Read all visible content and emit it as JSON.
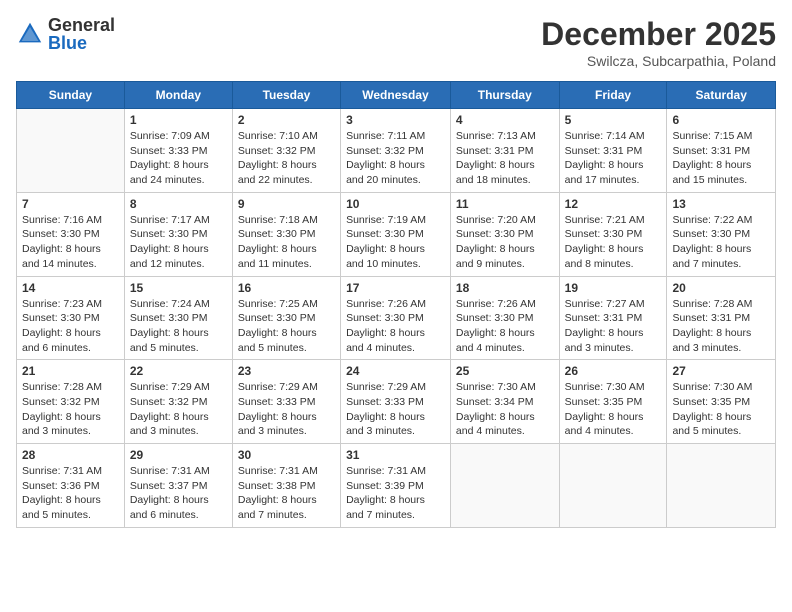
{
  "header": {
    "logo_general": "General",
    "logo_blue": "Blue",
    "month": "December 2025",
    "location": "Swilcza, Subcarpathia, Poland"
  },
  "weekdays": [
    "Sunday",
    "Monday",
    "Tuesday",
    "Wednesday",
    "Thursday",
    "Friday",
    "Saturday"
  ],
  "weeks": [
    [
      {
        "day": "",
        "info": ""
      },
      {
        "day": "1",
        "info": "Sunrise: 7:09 AM\nSunset: 3:33 PM\nDaylight: 8 hours\nand 24 minutes."
      },
      {
        "day": "2",
        "info": "Sunrise: 7:10 AM\nSunset: 3:32 PM\nDaylight: 8 hours\nand 22 minutes."
      },
      {
        "day": "3",
        "info": "Sunrise: 7:11 AM\nSunset: 3:32 PM\nDaylight: 8 hours\nand 20 minutes."
      },
      {
        "day": "4",
        "info": "Sunrise: 7:13 AM\nSunset: 3:31 PM\nDaylight: 8 hours\nand 18 minutes."
      },
      {
        "day": "5",
        "info": "Sunrise: 7:14 AM\nSunset: 3:31 PM\nDaylight: 8 hours\nand 17 minutes."
      },
      {
        "day": "6",
        "info": "Sunrise: 7:15 AM\nSunset: 3:31 PM\nDaylight: 8 hours\nand 15 minutes."
      }
    ],
    [
      {
        "day": "7",
        "info": "Sunrise: 7:16 AM\nSunset: 3:30 PM\nDaylight: 8 hours\nand 14 minutes."
      },
      {
        "day": "8",
        "info": "Sunrise: 7:17 AM\nSunset: 3:30 PM\nDaylight: 8 hours\nand 12 minutes."
      },
      {
        "day": "9",
        "info": "Sunrise: 7:18 AM\nSunset: 3:30 PM\nDaylight: 8 hours\nand 11 minutes."
      },
      {
        "day": "10",
        "info": "Sunrise: 7:19 AM\nSunset: 3:30 PM\nDaylight: 8 hours\nand 10 minutes."
      },
      {
        "day": "11",
        "info": "Sunrise: 7:20 AM\nSunset: 3:30 PM\nDaylight: 8 hours\nand 9 minutes."
      },
      {
        "day": "12",
        "info": "Sunrise: 7:21 AM\nSunset: 3:30 PM\nDaylight: 8 hours\nand 8 minutes."
      },
      {
        "day": "13",
        "info": "Sunrise: 7:22 AM\nSunset: 3:30 PM\nDaylight: 8 hours\nand 7 minutes."
      }
    ],
    [
      {
        "day": "14",
        "info": "Sunrise: 7:23 AM\nSunset: 3:30 PM\nDaylight: 8 hours\nand 6 minutes."
      },
      {
        "day": "15",
        "info": "Sunrise: 7:24 AM\nSunset: 3:30 PM\nDaylight: 8 hours\nand 5 minutes."
      },
      {
        "day": "16",
        "info": "Sunrise: 7:25 AM\nSunset: 3:30 PM\nDaylight: 8 hours\nand 5 minutes."
      },
      {
        "day": "17",
        "info": "Sunrise: 7:26 AM\nSunset: 3:30 PM\nDaylight: 8 hours\nand 4 minutes."
      },
      {
        "day": "18",
        "info": "Sunrise: 7:26 AM\nSunset: 3:30 PM\nDaylight: 8 hours\nand 4 minutes."
      },
      {
        "day": "19",
        "info": "Sunrise: 7:27 AM\nSunset: 3:31 PM\nDaylight: 8 hours\nand 3 minutes."
      },
      {
        "day": "20",
        "info": "Sunrise: 7:28 AM\nSunset: 3:31 PM\nDaylight: 8 hours\nand 3 minutes."
      }
    ],
    [
      {
        "day": "21",
        "info": "Sunrise: 7:28 AM\nSunset: 3:32 PM\nDaylight: 8 hours\nand 3 minutes."
      },
      {
        "day": "22",
        "info": "Sunrise: 7:29 AM\nSunset: 3:32 PM\nDaylight: 8 hours\nand 3 minutes."
      },
      {
        "day": "23",
        "info": "Sunrise: 7:29 AM\nSunset: 3:33 PM\nDaylight: 8 hours\nand 3 minutes."
      },
      {
        "day": "24",
        "info": "Sunrise: 7:29 AM\nSunset: 3:33 PM\nDaylight: 8 hours\nand 3 minutes."
      },
      {
        "day": "25",
        "info": "Sunrise: 7:30 AM\nSunset: 3:34 PM\nDaylight: 8 hours\nand 4 minutes."
      },
      {
        "day": "26",
        "info": "Sunrise: 7:30 AM\nSunset: 3:35 PM\nDaylight: 8 hours\nand 4 minutes."
      },
      {
        "day": "27",
        "info": "Sunrise: 7:30 AM\nSunset: 3:35 PM\nDaylight: 8 hours\nand 5 minutes."
      }
    ],
    [
      {
        "day": "28",
        "info": "Sunrise: 7:31 AM\nSunset: 3:36 PM\nDaylight: 8 hours\nand 5 minutes."
      },
      {
        "day": "29",
        "info": "Sunrise: 7:31 AM\nSunset: 3:37 PM\nDaylight: 8 hours\nand 6 minutes."
      },
      {
        "day": "30",
        "info": "Sunrise: 7:31 AM\nSunset: 3:38 PM\nDaylight: 8 hours\nand 7 minutes."
      },
      {
        "day": "31",
        "info": "Sunrise: 7:31 AM\nSunset: 3:39 PM\nDaylight: 8 hours\nand 7 minutes."
      },
      {
        "day": "",
        "info": ""
      },
      {
        "day": "",
        "info": ""
      },
      {
        "day": "",
        "info": ""
      }
    ]
  ]
}
